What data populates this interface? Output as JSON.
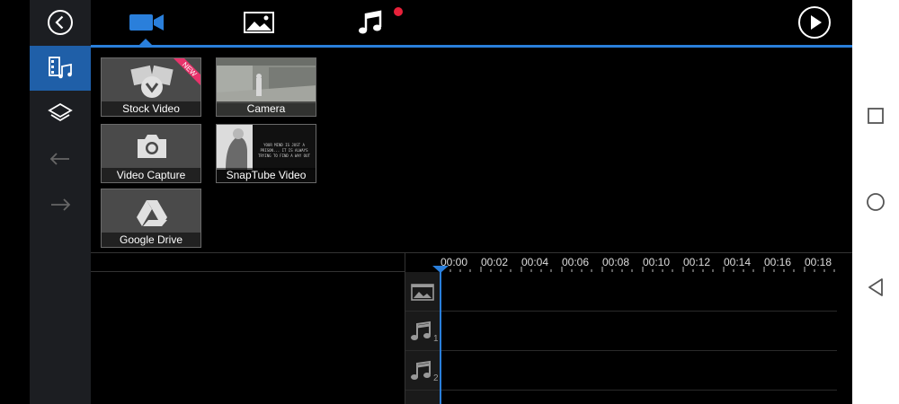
{
  "colors": {
    "accent": "#2a7fdb",
    "new_badge": "#e8336b",
    "notification_dot": "#e8213a"
  },
  "sidebar": {
    "items": [
      {
        "icon": "back-circle-icon"
      },
      {
        "icon": "media-library-icon",
        "active": true
      },
      {
        "icon": "layers-icon"
      },
      {
        "icon": "undo-icon"
      },
      {
        "icon": "redo-icon"
      }
    ]
  },
  "topbar": {
    "tabs": [
      {
        "icon": "video-camera-icon",
        "active": true
      },
      {
        "icon": "image-icon"
      },
      {
        "icon": "music-note-icon",
        "has_notification_dot": true
      }
    ],
    "play_icon": "play-circle-icon"
  },
  "media_sources": {
    "tiles": [
      {
        "label": "Stock Video",
        "badge": "NEW",
        "icon": "stock-photos-icon"
      },
      {
        "label": "Camera",
        "icon": "camera-thumbnail"
      },
      {
        "label": "Video Capture",
        "icon": "camera-icon"
      },
      {
        "label": "SnapTube Video",
        "icon": "snaptube-thumbnail",
        "thumb_text": "YOUR MIND IS JUST A PRISON... IT IS ALWAYS TRYING TO FIND A WAY OUT"
      },
      {
        "label": "Google Drive",
        "icon": "google-drive-icon"
      }
    ]
  },
  "timeline": {
    "ticks": [
      "00:00",
      "00:02",
      "00:04",
      "00:06",
      "00:08",
      "00:10",
      "00:12",
      "00:14",
      "00:16",
      "00:18"
    ],
    "tracks": [
      {
        "icon": "image-track-icon",
        "number": ""
      },
      {
        "icon": "music-track-icon",
        "number": "1"
      },
      {
        "icon": "music-track-icon",
        "number": "2"
      }
    ]
  },
  "navbar": {
    "buttons": [
      "recent-apps-icon",
      "home-icon",
      "back-icon"
    ]
  }
}
